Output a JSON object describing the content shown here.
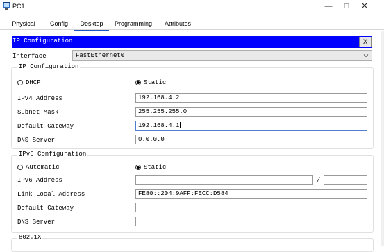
{
  "window": {
    "title": "PC1",
    "controls": {
      "minimize": "—",
      "maximize": "☐",
      "close": "✕"
    }
  },
  "tabs": [
    {
      "label": "Physical"
    },
    {
      "label": "Config"
    },
    {
      "label": "Desktop",
      "active": true
    },
    {
      "label": "Programming"
    },
    {
      "label": "Attributes"
    }
  ],
  "header": {
    "title": "IP Configuration",
    "close_label": "X",
    "color": "#0000ff"
  },
  "interface": {
    "label": "Interface",
    "value": "FastEthernet0"
  },
  "ipv4": {
    "section_title": "IP Configuration",
    "dhcp_label": "DHCP",
    "static_label": "Static",
    "mode": "Static",
    "address_label": "IPv4 Address",
    "address_value": "192.168.4.2",
    "mask_label": "Subnet Mask",
    "mask_value": "255.255.255.0",
    "gateway_label": "Default Gateway",
    "gateway_value": "192.168.4.1",
    "dns_label": "DNS Server",
    "dns_value": "0.0.0.0"
  },
  "ipv6": {
    "section_title": "IPv6 Configuration",
    "automatic_label": "Automatic",
    "static_label": "Static",
    "mode": "Static",
    "address_label": "IPv6 Address",
    "address_value": "",
    "prefix_value": "",
    "separator": "/",
    "link_local_label": "Link Local Address",
    "link_local_value": "FE80::204:9AFF:FECC:D584",
    "gateway_label": "Default Gateway",
    "gateway_value": "",
    "dns_label": "DNS Server",
    "dns_value": ""
  },
  "dot1x": {
    "section_title": "802.1X"
  }
}
